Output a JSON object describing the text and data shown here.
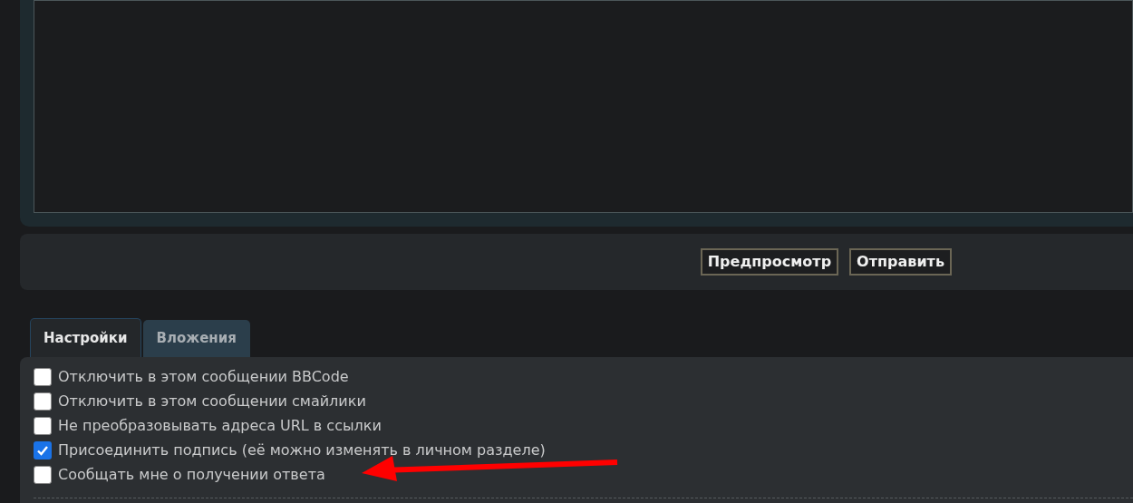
{
  "buttons": [
    {
      "label": "Предпросмотр"
    },
    {
      "label": "Отправить"
    }
  ],
  "tabs": [
    {
      "label": "Настройки",
      "selected": true
    },
    {
      "label": "Вложения",
      "selected": false
    }
  ],
  "options": [
    {
      "label": "Отключить в этом сообщении BBCode",
      "checked": false
    },
    {
      "label": "Отключить в этом сообщении смайлики",
      "checked": false
    },
    {
      "label": "Не преобразовывать адреса URL в ссылки",
      "checked": false
    },
    {
      "label": "Присоединить подпись (её можно изменять в личном разделе)",
      "checked": true
    },
    {
      "label": "Сообщать мне о получении ответа",
      "checked": false
    }
  ]
}
